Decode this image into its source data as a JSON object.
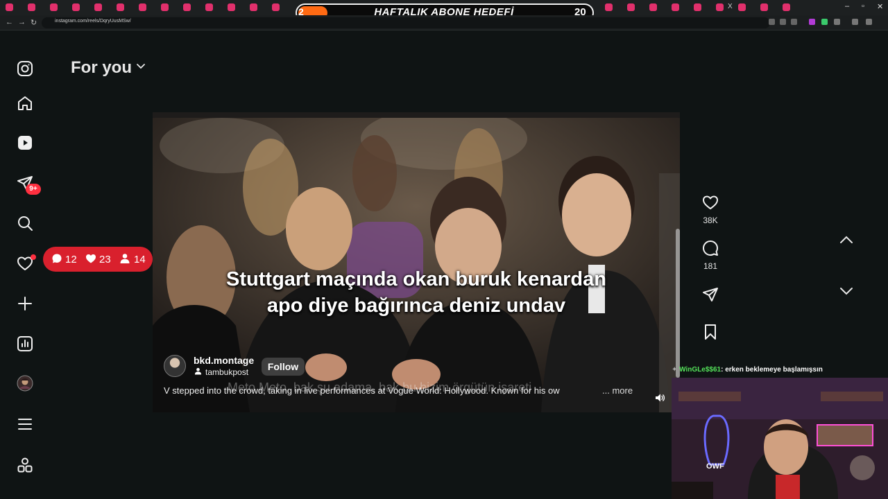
{
  "browser": {
    "url": "instagram.com/reels/DqryUusMSw/",
    "tab_close_glyph": "X"
  },
  "stream_goal": {
    "current": "2",
    "title": "HAFTALIK ABONE HEDEFİ",
    "target": "20",
    "progress_fraction": 0.1
  },
  "sidebar": {
    "items": [
      {
        "name": "instagram-logo-icon"
      },
      {
        "name": "home-icon"
      },
      {
        "name": "reels-icon"
      },
      {
        "name": "messages-icon"
      },
      {
        "name": "search-icon"
      },
      {
        "name": "notifications-icon"
      },
      {
        "name": "create-icon"
      },
      {
        "name": "dashboard-icon"
      },
      {
        "name": "profile-avatar"
      },
      {
        "name": "menu-icon"
      },
      {
        "name": "also-from-meta-icon"
      }
    ],
    "messages_badge": "9+"
  },
  "header": {
    "title": "For you"
  },
  "activity_pill": {
    "comments": "12",
    "likes": "23",
    "followers": "14",
    "color": "#d9202d"
  },
  "reel": {
    "caption_line1": "Stuttgart maçında okan buruk kenardan",
    "caption_line2": "apo diye bağırınca deniz undav",
    "overlay_text": "Meto Meto, bak şu adama, bak bu bizim örgütün işareti",
    "author": "bkd.montage",
    "collab": "tambukpost",
    "follow_label": "Follow",
    "description": "V stepped into the crowd, taking in live performances at Vogue World: Hollywood. Known for his ow",
    "more_label": "... more"
  },
  "actions": {
    "likes": "38K",
    "comments": "181"
  },
  "stream_chat": {
    "user": "WinGLe$$61",
    "message": ": erken beklemeye başlamışsın"
  },
  "colors": {
    "background": "#0f1414",
    "accent_red": "#ff3040",
    "goal_orange": "#ff6a13"
  }
}
